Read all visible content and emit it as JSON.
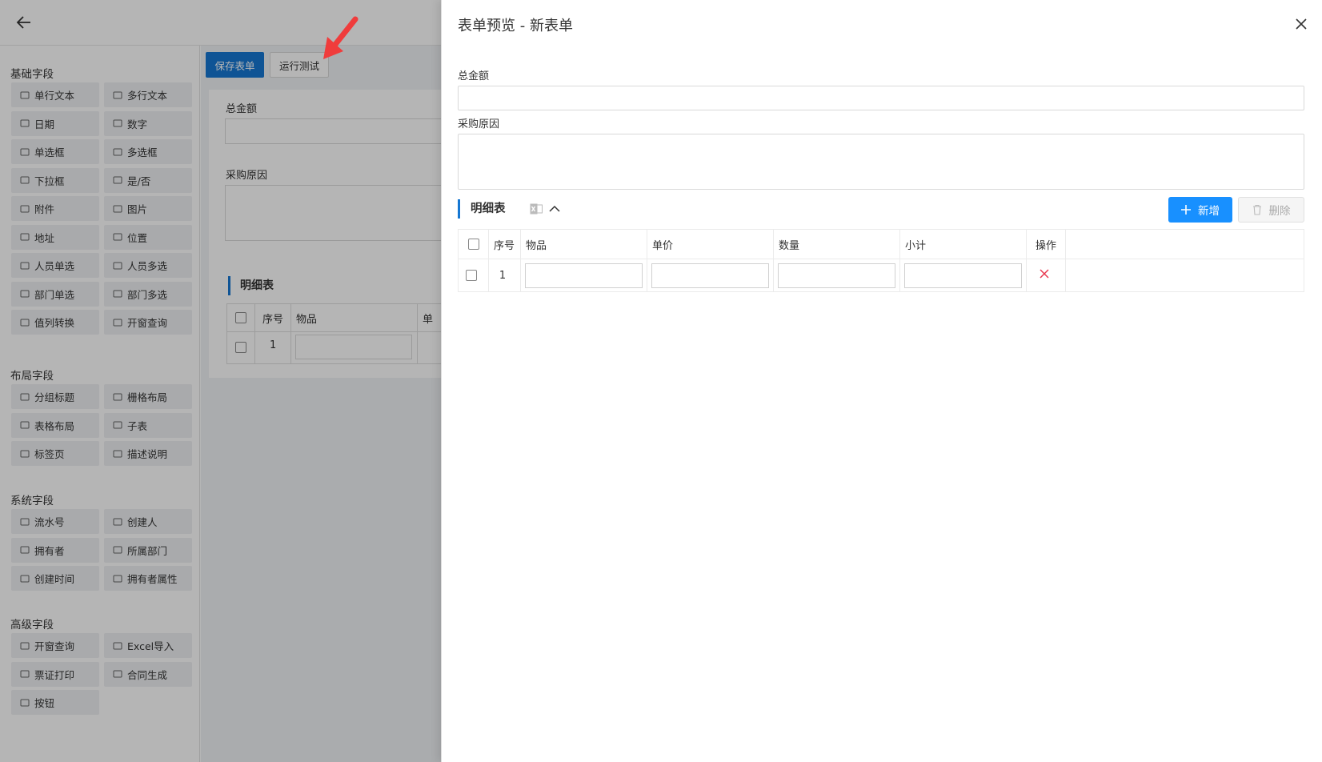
{
  "toolbar": {
    "save_label": "保存表单",
    "run_label": "运行测试"
  },
  "sidebar": {
    "groups": [
      {
        "title": "基础字段",
        "items": [
          "单行文本",
          "多行文本",
          "日期",
          "数字",
          "单选框",
          "多选框",
          "下拉框",
          "是/否",
          "附件",
          "图片",
          "地址",
          "位置",
          "人员单选",
          "人员多选",
          "部门单选",
          "部门多选",
          "值列转换",
          "开窗查询"
        ]
      },
      {
        "title": "布局字段",
        "items": [
          "分组标题",
          "栅格布局",
          "表格布局",
          "子表",
          "标签页",
          "描述说明"
        ]
      },
      {
        "title": "系统字段",
        "items": [
          "流水号",
          "创建人",
          "拥有者",
          "所属部门",
          "创建时间",
          "拥有者属性"
        ]
      },
      {
        "title": "高级字段",
        "items": [
          "开窗查询",
          "Excel导入",
          "票证打印",
          "合同生成",
          "按钮"
        ]
      }
    ]
  },
  "canvas": {
    "fields": [
      "总金额",
      "采购原因"
    ],
    "subtable_title": "明细表",
    "columns": [
      "序号",
      "物品",
      "单"
    ],
    "row_index": "1"
  },
  "drawer": {
    "title": "表单预览 - 新表单",
    "fields": [
      {
        "label": "总金额",
        "value": ""
      },
      {
        "label": "采购原因",
        "value": ""
      }
    ],
    "subtable": {
      "title": "明细表",
      "add_label": "新增",
      "delete_label": "删除",
      "columns": [
        "序号",
        "物品",
        "单价",
        "数量",
        "小计",
        "操作"
      ],
      "rows": [
        {
          "index": "1",
          "cells": [
            "",
            "",
            "",
            ""
          ]
        }
      ]
    }
  },
  "colors": {
    "primary": "#1677d2",
    "add_button": "#1890ff",
    "delete_icon": "#e8384f",
    "arrow": "#f03c3c"
  }
}
